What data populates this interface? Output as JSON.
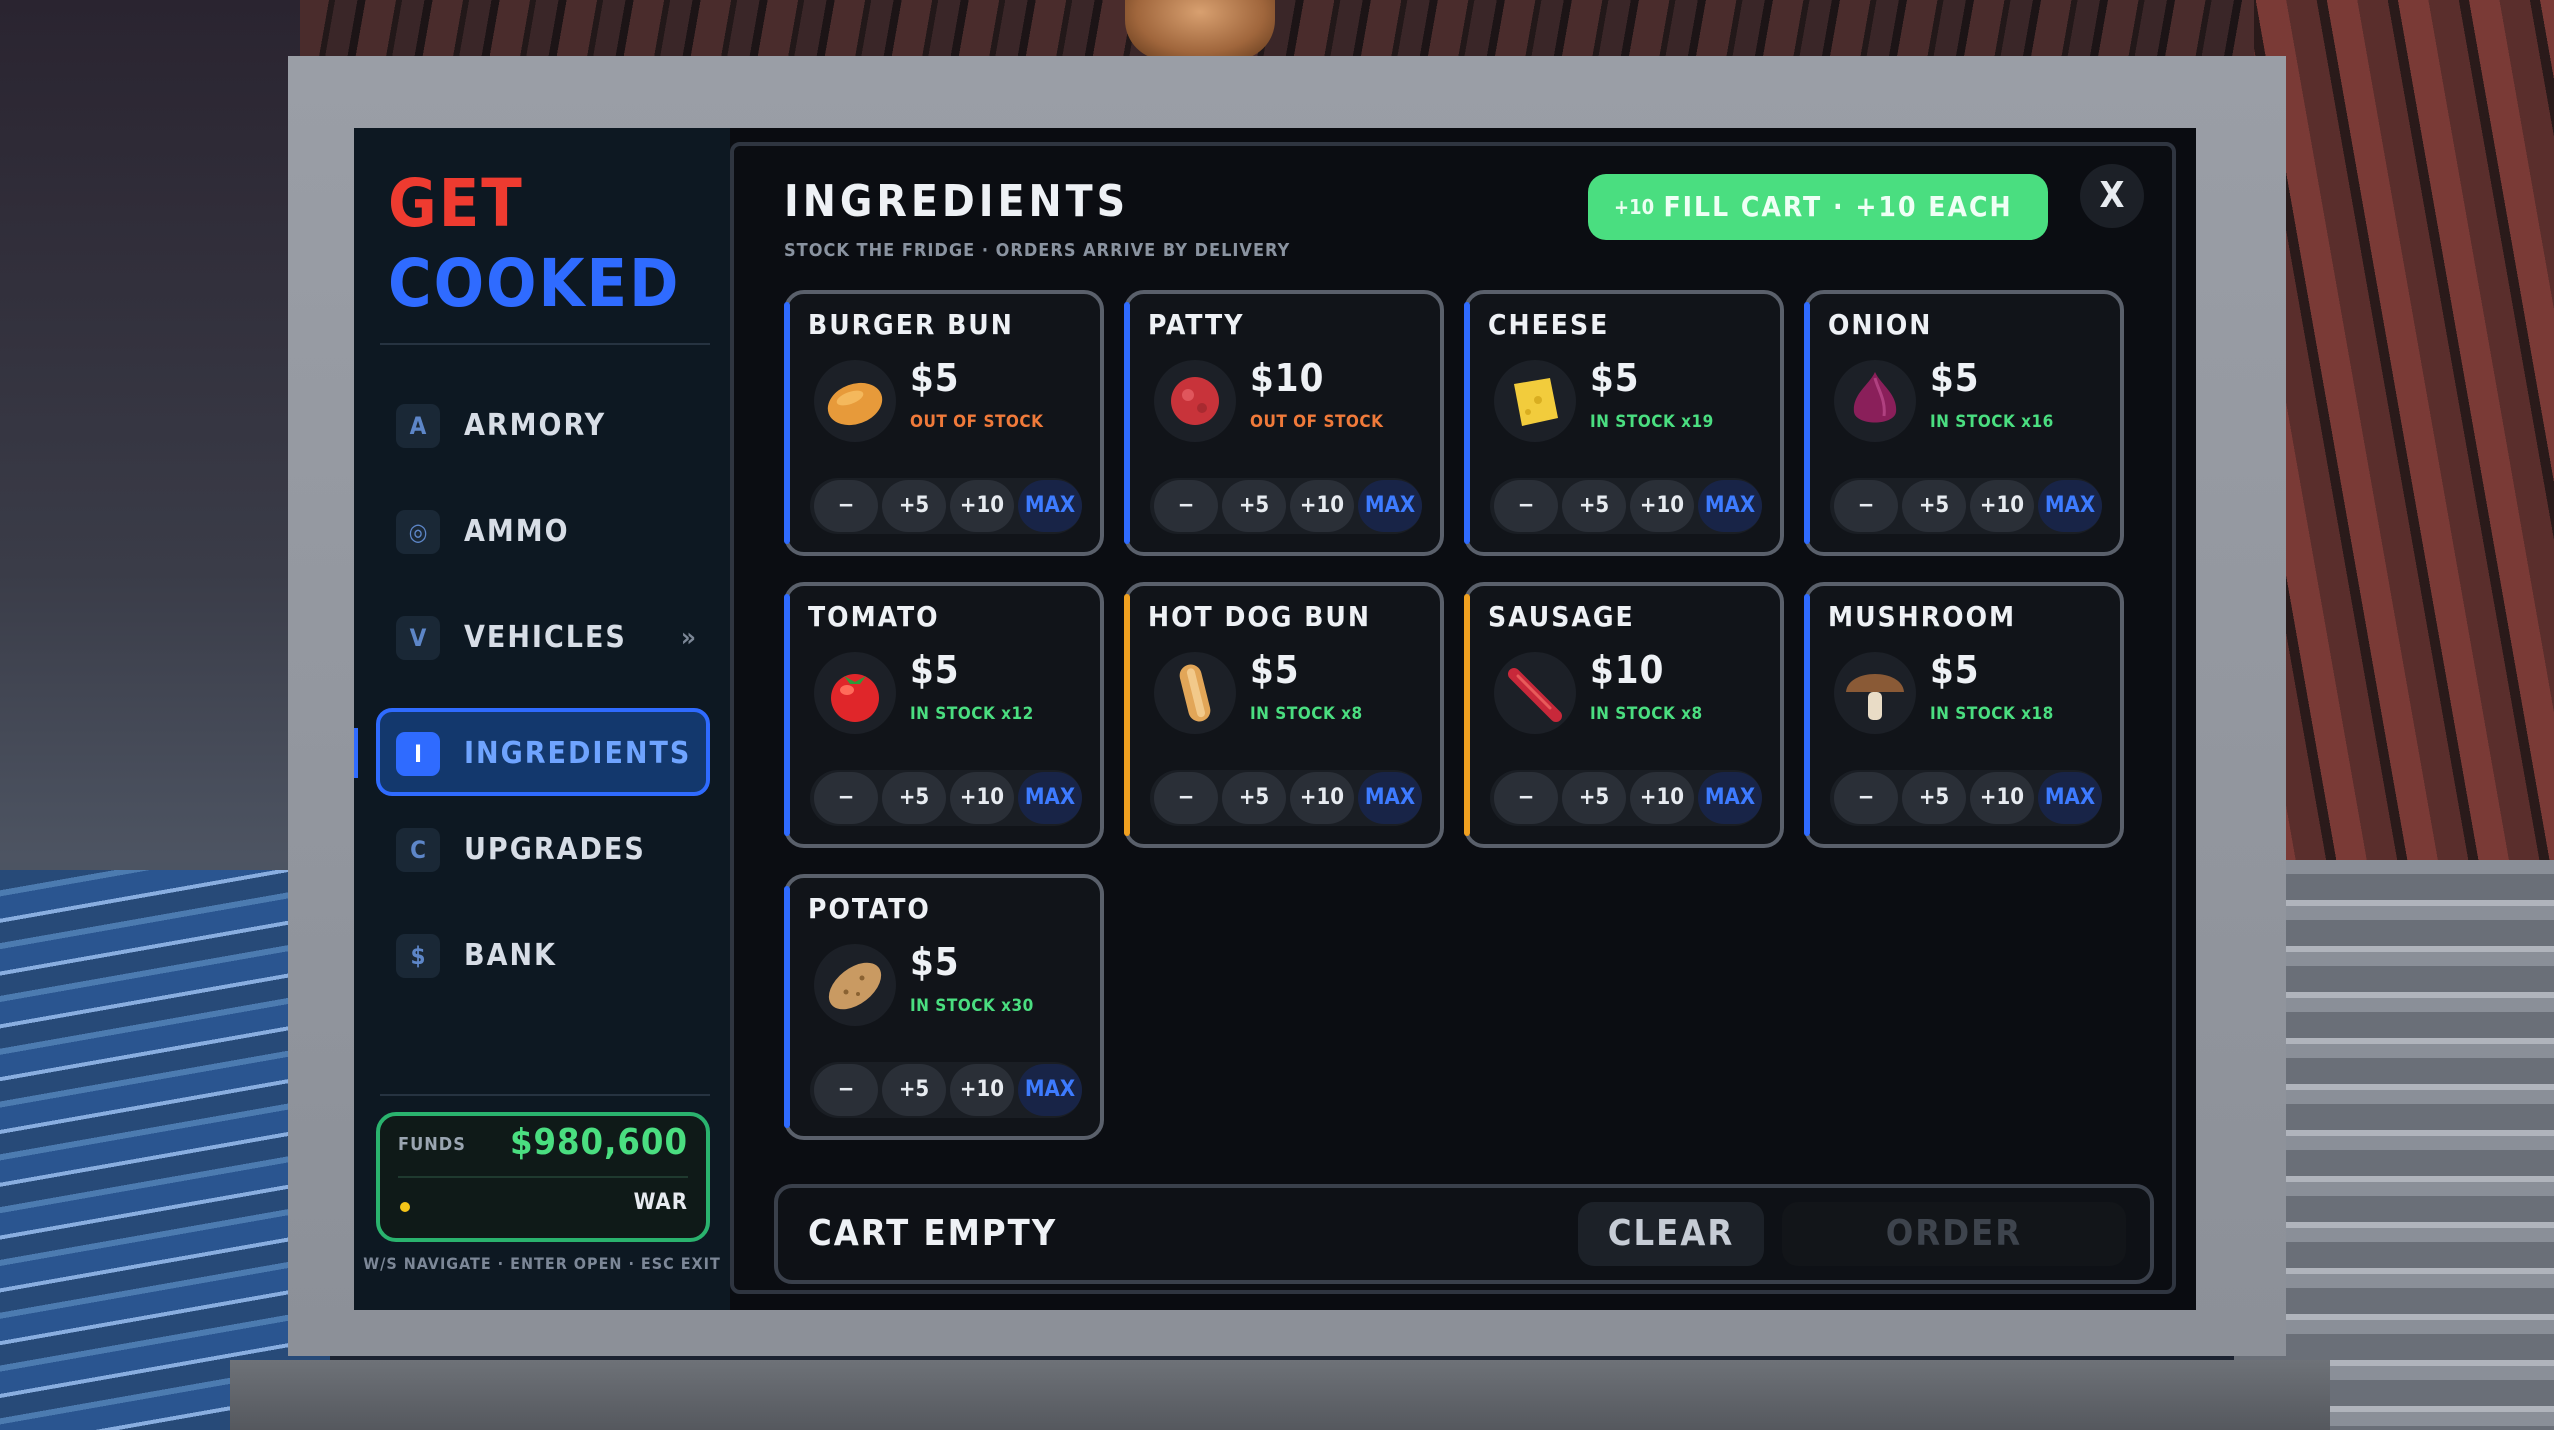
{
  "brand": {
    "line1": "GET",
    "line2": "COOKED"
  },
  "nav": [
    {
      "key": "A",
      "label": "ARMORY",
      "arrow": ""
    },
    {
      "key": "◎",
      "label": "AMMO",
      "arrow": ""
    },
    {
      "key": "V",
      "label": "VEHICLES",
      "arrow": "»"
    },
    {
      "key": "I",
      "label": "INGREDIENTS",
      "arrow": ""
    },
    {
      "key": "C",
      "label": "UPGRADES",
      "arrow": ""
    },
    {
      "key": "$",
      "label": "BANK",
      "arrow": ""
    }
  ],
  "funds": {
    "label": "FUNDS",
    "value": "$980,600",
    "mode": "WAR"
  },
  "hint": "W/S NAVIGATE · ENTER OPEN · ESC EXIT",
  "header": {
    "title": "INGREDIENTS",
    "subtitle": "STOCK THE FRIDGE · ORDERS ARRIVE BY DELIVERY",
    "fill_badge": "+10",
    "fill_label": "FILL CART · +10 EACH",
    "close": "X"
  },
  "buttons": {
    "minus": "−",
    "plus5": "+5",
    "plus10": "+10",
    "max": "MAX"
  },
  "items": [
    {
      "name": "BURGER BUN",
      "price": "$5",
      "stock": "OUT OF STOCK",
      "in_stock": false,
      "accent": "#2f6bff",
      "icon": "bun-icon"
    },
    {
      "name": "PATTY",
      "price": "$10",
      "stock": "OUT OF STOCK",
      "in_stock": false,
      "accent": "#2f6bff",
      "icon": "patty-icon"
    },
    {
      "name": "CHEESE",
      "price": "$5",
      "stock": "IN STOCK x19",
      "in_stock": true,
      "accent": "#2f6bff",
      "icon": "cheese-icon"
    },
    {
      "name": "ONION",
      "price": "$5",
      "stock": "IN STOCK x16",
      "in_stock": true,
      "accent": "#2f6bff",
      "icon": "onion-icon"
    },
    {
      "name": "TOMATO",
      "price": "$5",
      "stock": "IN STOCK x12",
      "in_stock": true,
      "accent": "#2f6bff",
      "icon": "tomato-icon"
    },
    {
      "name": "HOT DOG BUN",
      "price": "$5",
      "stock": "IN STOCK x8",
      "in_stock": true,
      "accent": "#f0a020",
      "icon": "hotdog-bun-icon"
    },
    {
      "name": "SAUSAGE",
      "price": "$10",
      "stock": "IN STOCK x8",
      "in_stock": true,
      "accent": "#f0a020",
      "icon": "sausage-icon"
    },
    {
      "name": "MUSHROOM",
      "price": "$5",
      "stock": "IN STOCK x18",
      "in_stock": true,
      "accent": "#2f6bff",
      "icon": "mushroom-icon"
    },
    {
      "name": "POTATO",
      "price": "$5",
      "stock": "IN STOCK x30",
      "in_stock": true,
      "accent": "#2f6bff",
      "icon": "potato-icon"
    }
  ],
  "cart": {
    "label": "CART EMPTY",
    "clear": "CLEAR",
    "order": "ORDER"
  },
  "colors": {
    "accent_blue": "#2f6bff",
    "accent_orange": "#f0a020",
    "green": "#4ade80",
    "out_of_stock": "#f07a3a",
    "in_stock": "#4ade80"
  }
}
